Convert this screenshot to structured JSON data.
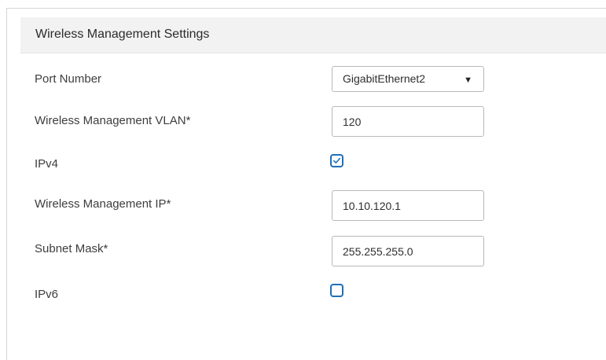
{
  "section": {
    "title": "Wireless Management Settings"
  },
  "fields": {
    "port_number": {
      "label": "Port Number",
      "value": "GigabitEthernet2",
      "icon": "chevron-down-icon"
    },
    "mgmt_vlan": {
      "label": "Wireless Management VLAN*",
      "value": "120"
    },
    "ipv4": {
      "label": "IPv4",
      "checked": true
    },
    "mgmt_ip": {
      "label": "Wireless Management IP*",
      "value": "10.10.120.1"
    },
    "subnet_mask": {
      "label": "Subnet Mask*",
      "value": "255.255.255.0"
    },
    "ipv6": {
      "label": "IPv6",
      "checked": false
    }
  },
  "colors": {
    "checkbox_accent": "#1f6fb8",
    "header_background": "#f2f2f2"
  }
}
